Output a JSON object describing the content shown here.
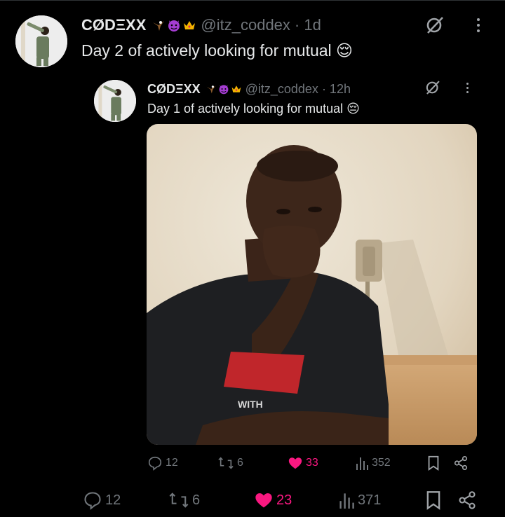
{
  "outer_post": {
    "display_name": "CØDΞXX",
    "handle": "@itz_coddex",
    "time": "· 1d",
    "text": "Day 2 of actively looking for mutual 😌",
    "actions": {
      "replies": "12",
      "reposts": "6",
      "likes": "23",
      "views": "371"
    }
  },
  "quoted_post": {
    "display_name": "CØDΞXX",
    "handle": "@itz_coddex",
    "time": "· 12h",
    "text": "Day 1 of actively looking for mutual 😔",
    "actions": {
      "replies": "12",
      "reposts": "6",
      "likes": "33",
      "views": "352"
    },
    "photo_shirt_text": "WITH"
  },
  "icons": [
    "grok-icon",
    "more-dots-icon",
    "reply-icon",
    "repost-icon",
    "like-icon",
    "views-icon",
    "bookmark-icon",
    "share-icon"
  ],
  "colors": {
    "background": "#000000",
    "text": "#e7e9ea",
    "muted": "#71767b",
    "like": "#f91880"
  }
}
